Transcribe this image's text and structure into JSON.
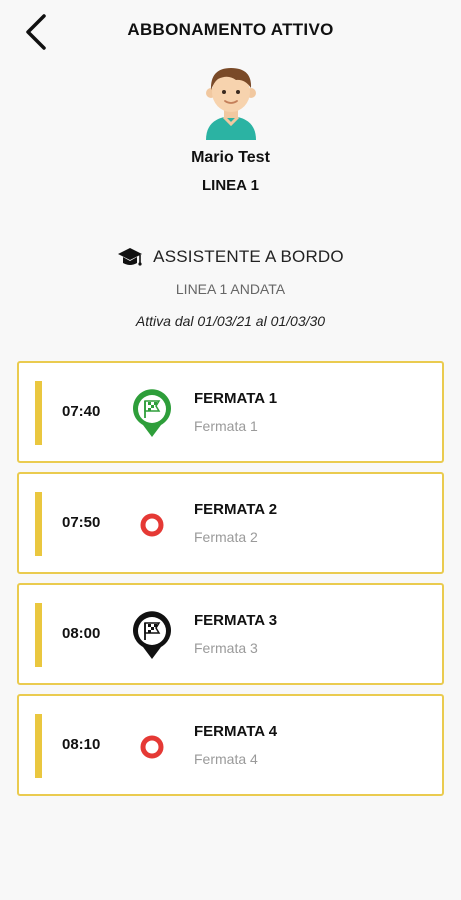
{
  "header": {
    "title": "ABBONAMENTO ATTIVO",
    "back_icon": "chevron-left-icon"
  },
  "user": {
    "name": "Mario Test",
    "line": "LINEA 1",
    "avatar_icon": "boy-avatar"
  },
  "role": {
    "icon": "graduation-cap-icon",
    "label": "ASSISTENTE A BORDO"
  },
  "route": {
    "label": "LINEA 1 ANDATA",
    "validity": "Attiva dal 01/03/21 al 01/03/30"
  },
  "stops": [
    {
      "time": "07:40",
      "title": "FERMATA 1",
      "subtitle": "Fermata 1",
      "marker": "flag-pin-green-icon"
    },
    {
      "time": "07:50",
      "title": "FERMATA 2",
      "subtitle": "Fermata 2",
      "marker": "stop-circle-red-icon"
    },
    {
      "time": "08:00",
      "title": "FERMATA 3",
      "subtitle": "Fermata 3",
      "marker": "flag-pin-black-icon"
    },
    {
      "time": "08:10",
      "title": "FERMATA 4",
      "subtitle": "Fermata 4",
      "marker": "stop-circle-red-icon"
    }
  ],
  "colors": {
    "accent": "#eac73f",
    "card_border": "#eacb4f",
    "green_marker": "#2e9e3a",
    "red_marker": "#e53935",
    "subtitle_grey": "#9a9a9a"
  }
}
